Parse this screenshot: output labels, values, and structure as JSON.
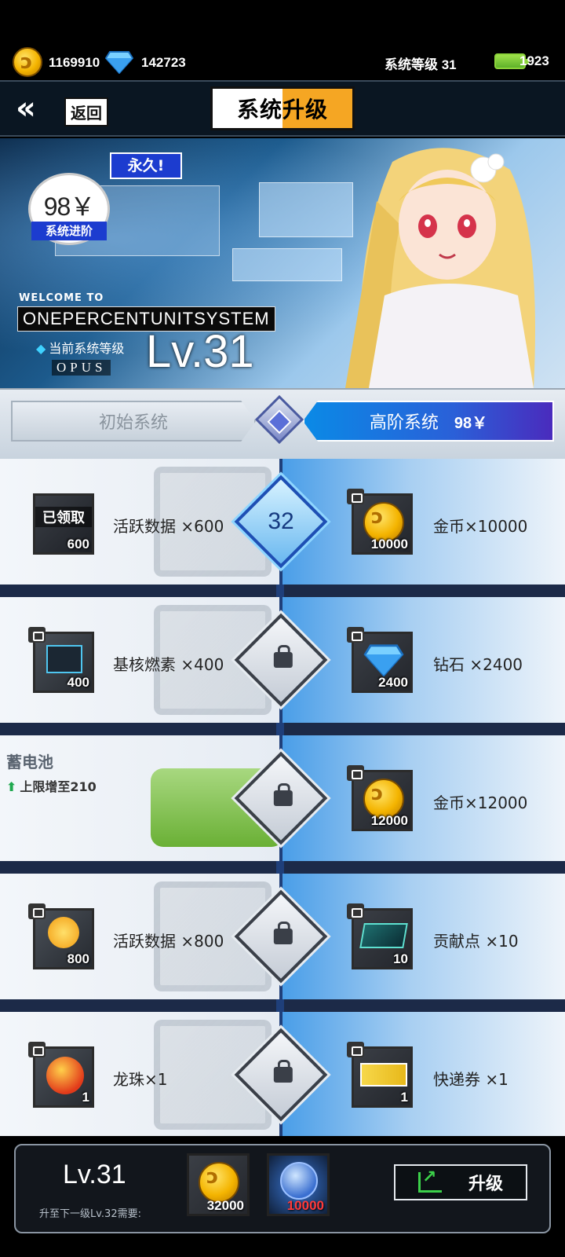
{
  "status": {
    "gold": "1169910",
    "diamond": "142723",
    "system_level_label": "系统等级 31",
    "energy": "1923"
  },
  "header": {
    "back_label": "返回",
    "title": "系统升级"
  },
  "banner": {
    "price": "98￥",
    "price_sub": "系统进阶",
    "forever": "永久!",
    "welcome": "WELCOME TO",
    "system_name": "ONEPERCENTUNITSYSTEM",
    "current_level_label": "当前系统等级",
    "opus": "OPUS",
    "level": "Lv.31"
  },
  "tabs": {
    "basic": "初始系统",
    "advanced": "高阶系统",
    "advanced_price": "98￥"
  },
  "rows": [
    {
      "left_label": "活跃数据  ×600",
      "left_qty": "600",
      "left_claimed": "已领取",
      "node": "32",
      "right_label": "金币×10000",
      "right_qty": "10000"
    },
    {
      "left_label": "基核燃素  ×400",
      "left_qty": "400",
      "right_label": "钻石  ×2400",
      "right_qty": "2400"
    },
    {
      "side_title": "蓄电池",
      "side_sub": "上限增至210",
      "right_label": "金币×12000",
      "right_qty": "12000"
    },
    {
      "left_label": "活跃数据  ×800",
      "left_qty": "800",
      "right_label": "贡献点  ×10",
      "right_qty": "10"
    },
    {
      "left_label": "龙珠×1",
      "left_qty": "1",
      "right_label": "快递券  ×1",
      "right_qty": "1"
    }
  ],
  "bottom": {
    "level": "Lv.31",
    "need": "升至下一级Lv.32需要:",
    "cost_gold": "32000",
    "cost_item": "10000",
    "upgrade": "升级"
  },
  "colors": {
    "accent_orange": "#f5a623",
    "accent_blue": "#1c3ccf",
    "tab_advanced": "#0a8ae6",
    "gold": "#f4b400",
    "energy_green": "#8cd43a"
  },
  "icons": [
    "gold-coin-icon",
    "diamond-icon",
    "battery-icon",
    "back-arrow-icon",
    "lock-icon",
    "chart-up-icon"
  ]
}
